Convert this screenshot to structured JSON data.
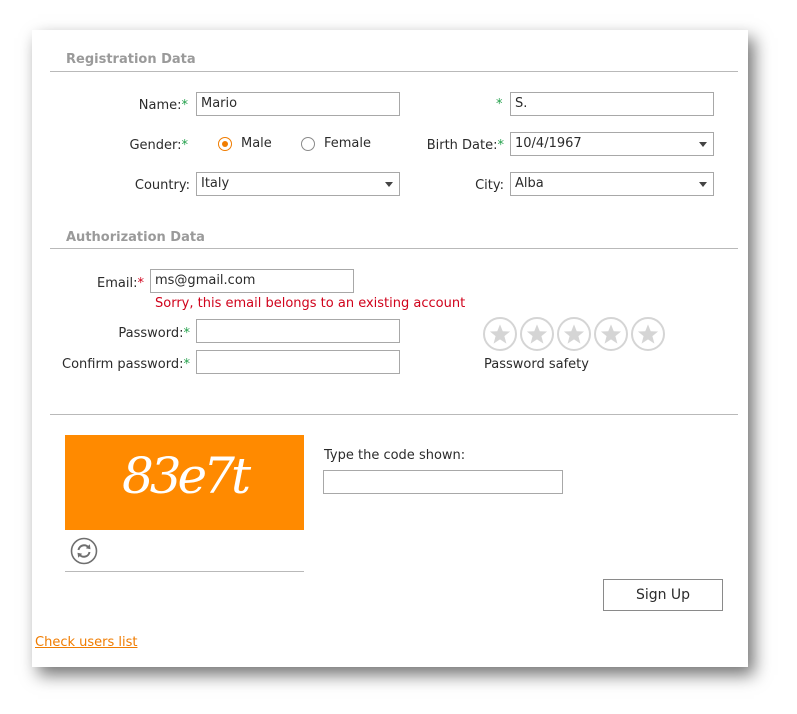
{
  "registration": {
    "title": "Registration Data",
    "name_label": "Name:",
    "first_name": "Mario",
    "last_name": "S.",
    "gender_label": "Gender:",
    "gender_options": [
      "Male",
      "Female"
    ],
    "gender_selected": "Male",
    "birth_date_label": "Birth Date:",
    "birth_date": "10/4/1967",
    "country_label": "Country:",
    "country": "Italy",
    "city_label": "City:",
    "city": "Alba",
    "required_mark": "*"
  },
  "authorization": {
    "title": "Authorization Data",
    "email_label": "Email:",
    "email": "ms@gmail.com",
    "email_error": "Sorry, this email belongs to an existing account",
    "password_label": "Password:",
    "password": "",
    "confirm_label": "Confirm password:",
    "confirm_password": "",
    "safety_label": "Password safety",
    "safety_rating": 0,
    "safety_max": 5
  },
  "captcha": {
    "code_image_text": "83e7t",
    "prompt": "Type the code shown:",
    "value": "",
    "refresh_icon": "refresh-icon",
    "background_color": "#ff8a00"
  },
  "actions": {
    "sign_up_label": "Sign Up",
    "check_users_link": "Check users list"
  },
  "colors": {
    "accent": "#f07c00",
    "error": "#d0021b",
    "required": "#22a04a"
  }
}
